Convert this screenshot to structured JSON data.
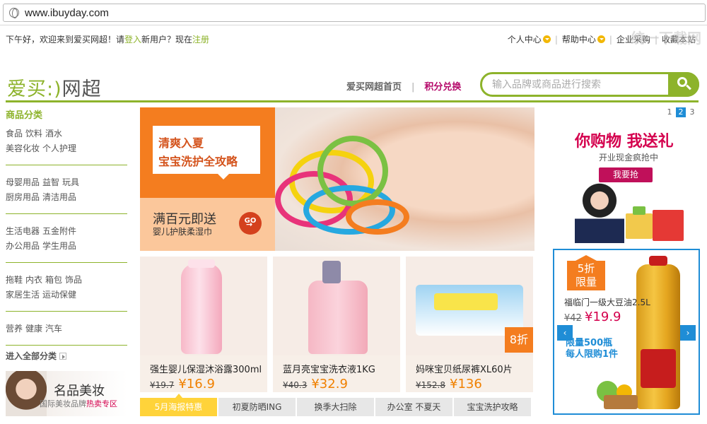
{
  "browser": {
    "url": "www.ibuyday.com"
  },
  "topbar": {
    "greeting_prefix": "下午好，欢迎来到爱买网超！请",
    "login": "登入",
    "greeting_mid": "新用户？现在",
    "register": "注册",
    "links": [
      "个人中心",
      "帮助中心",
      "企业采购",
      "收藏本站"
    ],
    "watermark": "统一下载网"
  },
  "header": {
    "logo_main": "爱买",
    "logo_mark": ":)",
    "logo_sub": "网超",
    "nav": [
      "爱买网超首页",
      "积分兑换"
    ],
    "search_placeholder": "输入品牌或商品进行搜索"
  },
  "categories": {
    "title": "商品分类",
    "groups": [
      [
        [
          "食品",
          "饮料",
          "酒水"
        ],
        [
          "美容化妆",
          "个人护理"
        ]
      ],
      [
        [
          "母婴用品",
          "益智",
          "玩具"
        ],
        [
          "厨房用品",
          "清洁用品"
        ]
      ],
      [
        [
          "生活电器",
          "五金附件"
        ],
        [
          "办公用品",
          "学生用品"
        ]
      ],
      [
        [
          "拖鞋",
          "内衣",
          "箱包",
          "饰品"
        ],
        [
          "家居生活",
          "运动保健"
        ]
      ],
      [
        [
          "营养",
          "健康",
          "汽车"
        ]
      ]
    ],
    "all_label": "进入全部分类"
  },
  "beauty_banner": {
    "title": "名品美妆",
    "sub_prefix": "国际美妆品牌",
    "sub_hot": "热卖专区"
  },
  "banner": {
    "headline_1": "清爽入夏",
    "headline_2": "宝宝洗护全攻略",
    "promo_1": "满百元即送",
    "promo_2": "婴儿护肤柔湿巾",
    "go": "GO",
    "pages": [
      "1",
      "2",
      "3"
    ],
    "active_page": "2"
  },
  "right_promo": {
    "headline": "你购物 我送礼",
    "sub": "开业现金疯抢中",
    "button": "我要抢"
  },
  "flash_deal": {
    "badge_1": "5折",
    "badge_2": "限量",
    "name": "福临门一级大豆油2.5L",
    "old_price": "¥42",
    "new_price": "¥19.9",
    "limit_1": "限量500瓶",
    "limit_2": "每人限购1件",
    "prev": "‹",
    "next": "›"
  },
  "products": [
    {
      "name": "强生婴儿保湿沐浴露300ml",
      "old_price": "¥19.7",
      "new_price": "¥16.9"
    },
    {
      "name": "蓝月亮宝宝洗衣液1KG",
      "old_price": "¥40.3",
      "new_price": "¥32.9"
    },
    {
      "name": "妈咪宝贝纸尿裤XL60片",
      "old_price": "¥152.8",
      "new_price": "¥136",
      "tag": "8折"
    }
  ],
  "tabs": [
    "5月海报特惠",
    "初夏防晒ING",
    "换季大扫除",
    "办公室 不夏天",
    "宝宝洗护攻略"
  ],
  "colors": {
    "brand_green": "#8db32b",
    "accent_orange": "#f47d1f",
    "accent_pink": "#d4004d",
    "accent_blue": "#1f8dd6",
    "tab_yellow": "#ffd33a"
  }
}
